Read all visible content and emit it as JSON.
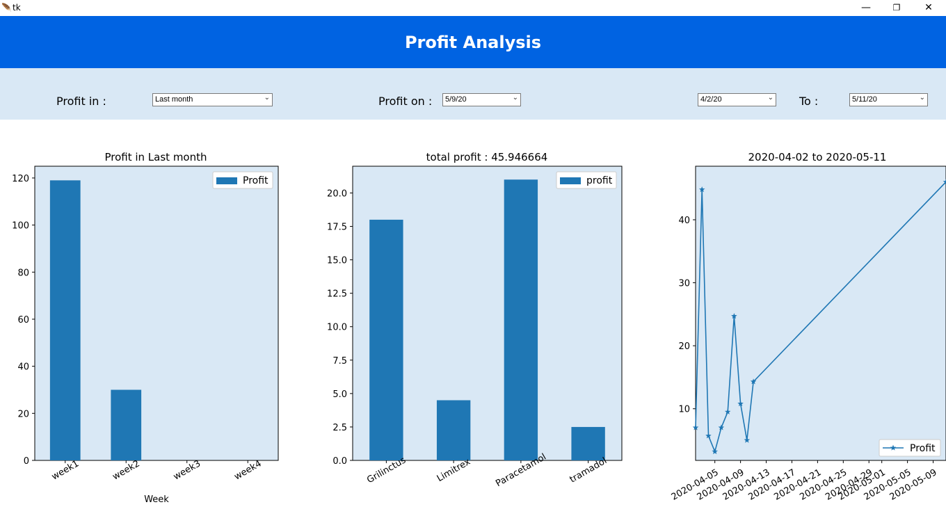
{
  "window": {
    "icon": "feather-icon",
    "title": "tk",
    "min": "—",
    "max": "❐",
    "close": "✕"
  },
  "header": {
    "title": "Profit Analysis"
  },
  "filters": {
    "profit_in_label": "Profit in :",
    "profit_in_value": "Last month",
    "profit_on_label": "Profit on :",
    "profit_on_value": "5/9/20",
    "from_value": "4/2/20",
    "to_label": "To :",
    "to_value": "5/11/20"
  },
  "colors": {
    "header": "#0063e2",
    "panel": "#d9e8f5",
    "bar": "#1f77b4"
  },
  "chart_data": [
    {
      "type": "bar",
      "title": "Profit in Last month",
      "xlabel": "Week",
      "ylabel": "",
      "categories": [
        "week1",
        "week2",
        "week3",
        "week4"
      ],
      "series": [
        {
          "name": "Profit",
          "values": [
            119,
            30,
            0,
            0
          ]
        }
      ],
      "ylim": [
        0,
        125
      ],
      "yticks": [
        "0",
        "20",
        "40",
        "60",
        "80",
        "100",
        "120"
      ],
      "legend": "top-right"
    },
    {
      "type": "bar",
      "title": "total profit : 45.946664",
      "xlabel": "",
      "ylabel": "",
      "categories": [
        "Grilinctus",
        "Limitrex",
        "Paracetamol",
        "tramadol"
      ],
      "series": [
        {
          "name": "profit",
          "values": [
            18,
            4.5,
            21,
            2.5
          ]
        }
      ],
      "ylim": [
        0,
        22
      ],
      "yticks": [
        "0.0",
        "2.5",
        "5.0",
        "7.5",
        "10.0",
        "12.5",
        "15.0",
        "17.5",
        "20.0"
      ],
      "legend": "top-right"
    },
    {
      "type": "line",
      "title": "2020-04-02 to 2020-05-11",
      "xlabel": "",
      "ylabel": "",
      "x": [
        "2020-04-02",
        "2020-04-03",
        "2020-04-04",
        "2020-04-05",
        "2020-04-06",
        "2020-04-07",
        "2020-04-08",
        "2020-04-09",
        "2020-04-10",
        "2020-04-11",
        "2020-05-11"
      ],
      "series": [
        {
          "name": "Profit",
          "values": [
            7,
            44.8,
            5.7,
            3.2,
            7,
            9.5,
            24.7,
            10.8,
            5,
            14.3,
            46
          ]
        }
      ],
      "ylim": [
        1.8,
        48.5
      ],
      "yticks": [
        "10",
        "20",
        "30",
        "40"
      ],
      "xticks": [
        "2020-04-05",
        "2020-04-09",
        "2020-04-13",
        "2020-04-17",
        "2020-04-21",
        "2020-04-25",
        "2020-04-29",
        "2020-05-01",
        "2020-05-05",
        "2020-05-09"
      ],
      "legend": "bottom-right",
      "marker": "star"
    }
  ]
}
